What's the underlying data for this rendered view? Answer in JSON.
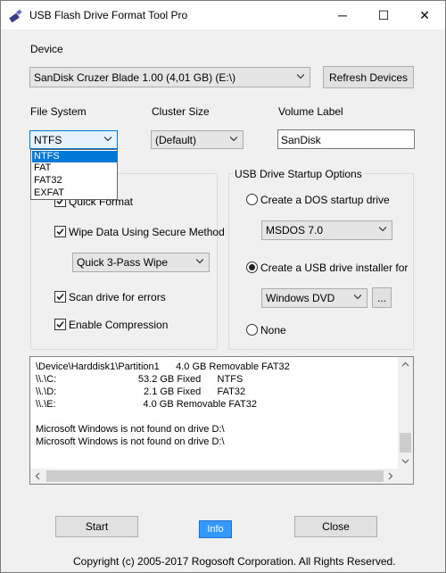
{
  "window": {
    "title": "USB Flash Drive Format Tool Pro",
    "minimize": "─",
    "maximize": "☐",
    "close": "✕"
  },
  "device": {
    "label": "Device",
    "selected": "SanDisk Cruzer Blade 1.00 (4,01 GB) (E:\\)",
    "refresh_label": "Refresh Devices"
  },
  "file_system": {
    "label": "File System",
    "selected": "NTFS",
    "options": [
      "NTFS",
      "FAT",
      "FAT32",
      "EXFAT"
    ]
  },
  "cluster_size": {
    "label": "Cluster Size",
    "selected": "(Default)"
  },
  "volume_label": {
    "label": "Volume Label",
    "value": "SanDisk"
  },
  "format_options": {
    "quick_format": "Quick Format",
    "wipe_data": "Wipe Data Using Secure Method",
    "wipe_method": "Quick 3-Pass Wipe",
    "scan_errors": "Scan drive for errors",
    "compression": "Enable Compression"
  },
  "startup": {
    "group_label": "USB Drive Startup Options",
    "dos_label": "Create a DOS startup drive",
    "dos_version": "MSDOS 7.0",
    "installer_label": "Create a USB drive installer for",
    "installer_target": "Windows DVD",
    "browse_label": "...",
    "none_label": "None"
  },
  "log": {
    "lines": [
      "\\Device\\Harddisk1\\Partition1      4.0 GB Removable FAT32",
      "\\\\.\\C:                              53.2 GB Fixed      NTFS",
      "\\\\.\\D:                                2.1 GB Fixed      FAT32",
      "\\\\.\\E:                                4.0 GB Removable FAT32",
      "",
      "Microsoft Windows is not found on drive D:\\",
      "Microsoft Windows is not found on drive D:\\"
    ]
  },
  "buttons": {
    "start": "Start",
    "info": "Info",
    "close": "Close"
  },
  "footer": {
    "copyright": "Copyright (c) 2005-2017 Rogosoft Corporation. All Rights Reserved."
  },
  "colors": {
    "accent": "#0078d7",
    "info_button": "#3399ff",
    "window_bg": "#f0f0f0"
  }
}
